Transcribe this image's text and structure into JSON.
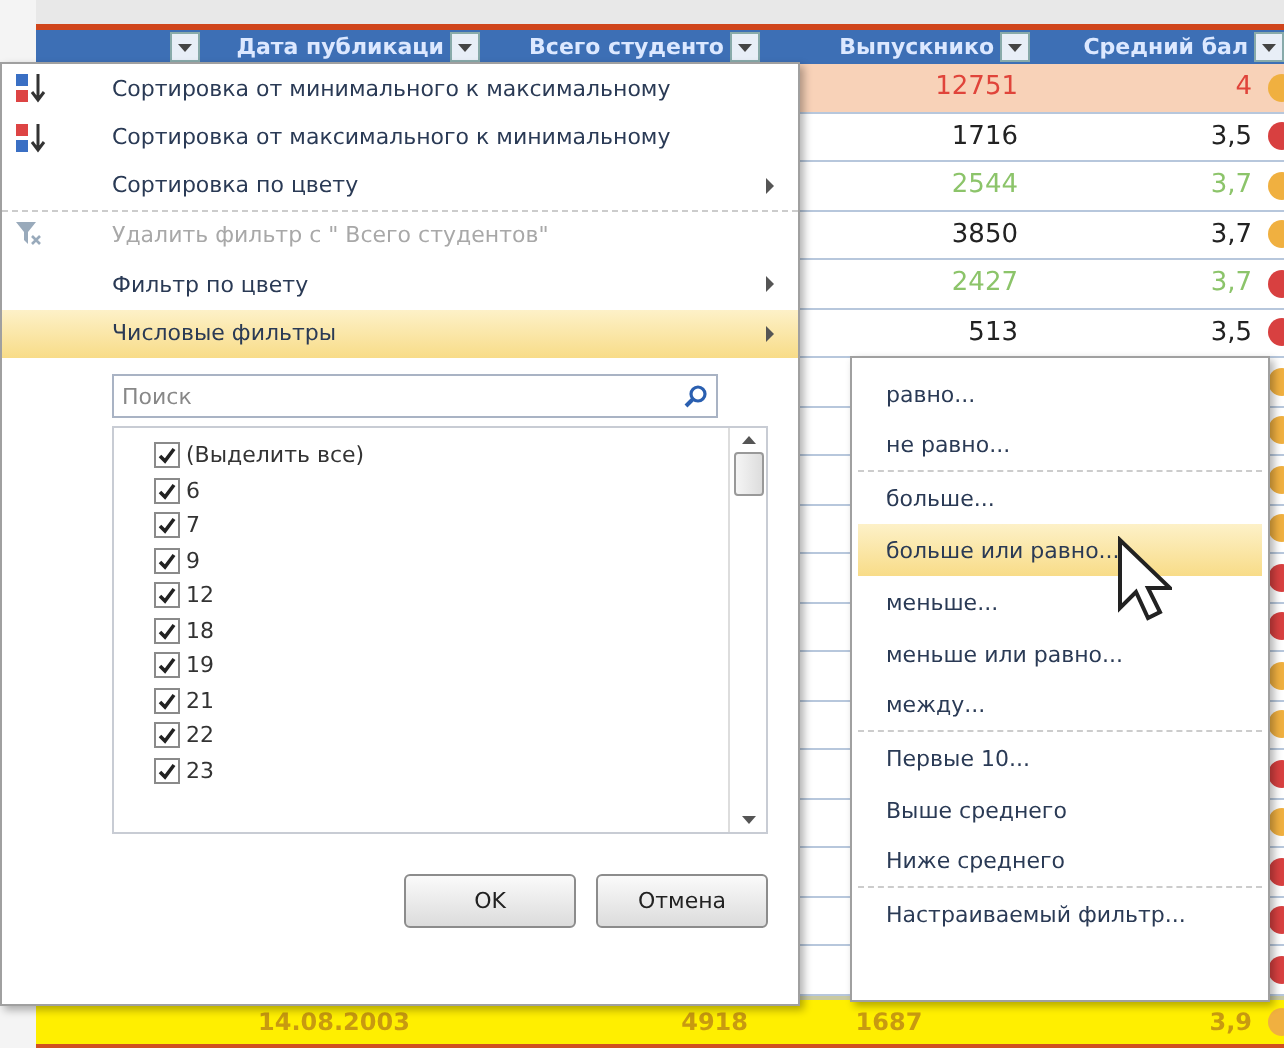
{
  "table": {
    "columns": [
      {
        "label": "Дата публикаци"
      },
      {
        "label": "Всего студенто"
      },
      {
        "label": "Выпускнико"
      },
      {
        "label": "Средний бал"
      }
    ],
    "rows": [
      {
        "graduates": "12751",
        "average": "4",
        "kind": "highlight",
        "color": "#f0b040"
      },
      {
        "graduates": "1716",
        "average": "3,5",
        "kind": "normal",
        "color": "#d84040"
      },
      {
        "graduates": "2544",
        "average": "3,7",
        "kind": "green",
        "color": "#f0b040"
      },
      {
        "graduates": "3850",
        "average": "3,7",
        "kind": "normal",
        "color": "#f0b040"
      },
      {
        "graduates": "2427",
        "average": "3,7",
        "kind": "green",
        "color": "#d84040"
      },
      {
        "graduates": "513",
        "average": "3,5",
        "kind": "normal",
        "color": "#d84040"
      }
    ],
    "covered_rows": [
      {
        "color": "#f0b040"
      },
      {
        "color": "#f0b040"
      },
      {
        "color": "#f0b040"
      },
      {
        "color": "#f0b040"
      },
      {
        "color": "#d84040"
      },
      {
        "color": "#d84040"
      },
      {
        "color": "#f0b040"
      },
      {
        "color": "#f0b040"
      },
      {
        "color": "#d84040"
      },
      {
        "color": "#f0b040"
      },
      {
        "color": "#d84040"
      },
      {
        "color": "#d84040"
      },
      {
        "color": "#d84040"
      }
    ],
    "total_row": {
      "date": "14.08.2003",
      "students": "4918",
      "graduates": "1687",
      "average": "3,9",
      "color": "#f0b040"
    }
  },
  "filter_menu": {
    "items": [
      {
        "label": "Сортировка от минимального к максимальному",
        "kind": "sort_asc",
        "disabled": false,
        "submenu": false,
        "selected": false,
        "separator_after": false
      },
      {
        "label": "Сортировка от максимального к минимальному",
        "kind": "sort_desc",
        "disabled": false,
        "submenu": false,
        "selected": false,
        "separator_after": false
      },
      {
        "label": "Сортировка по цвету",
        "kind": "plain",
        "disabled": false,
        "submenu": true,
        "selected": false,
        "separator_after": true
      },
      {
        "label": "Удалить фильтр с \" Всего студентов\"",
        "kind": "clear_filter",
        "disabled": true,
        "submenu": false,
        "selected": false,
        "separator_after": false
      },
      {
        "label": "Фильтр по цвету",
        "kind": "plain",
        "disabled": false,
        "submenu": true,
        "selected": false,
        "separator_after": false
      },
      {
        "label": "Числовые фильтры",
        "kind": "plain",
        "disabled": false,
        "submenu": true,
        "selected": true,
        "separator_after": false
      }
    ],
    "search": {
      "placeholder": "Поиск"
    },
    "values": [
      {
        "label": "(Выделить все)",
        "checked": true
      },
      {
        "label": "6",
        "checked": true
      },
      {
        "label": "7",
        "checked": true
      },
      {
        "label": "9",
        "checked": true
      },
      {
        "label": "12",
        "checked": true
      },
      {
        "label": "18",
        "checked": true
      },
      {
        "label": "19",
        "checked": true
      },
      {
        "label": "21",
        "checked": true
      },
      {
        "label": "22",
        "checked": true
      },
      {
        "label": "23",
        "checked": true
      }
    ],
    "buttons": [
      "OK",
      "Отмена"
    ]
  },
  "submenu": {
    "items": [
      {
        "label": "равно...",
        "selected": false,
        "separator_after": false
      },
      {
        "label": "не равно...",
        "selected": false,
        "separator_after": true
      },
      {
        "label": "больше...",
        "selected": false,
        "separator_after": false
      },
      {
        "label": "больше или равно...",
        "selected": true,
        "separator_after": false
      },
      {
        "label": "меньше...",
        "selected": false,
        "separator_after": false
      },
      {
        "label": "меньше или равно...",
        "selected": false,
        "separator_after": false
      },
      {
        "label": "между...",
        "selected": false,
        "separator_after": true
      },
      {
        "label": "Первые 10...",
        "selected": false,
        "separator_after": false
      },
      {
        "label": "Выше среднего",
        "selected": false,
        "separator_after": false
      },
      {
        "label": "Ниже среднего",
        "selected": false,
        "separator_after": true
      },
      {
        "label": "Настраиваемый фильтр...",
        "selected": false,
        "separator_after": false
      }
    ]
  }
}
